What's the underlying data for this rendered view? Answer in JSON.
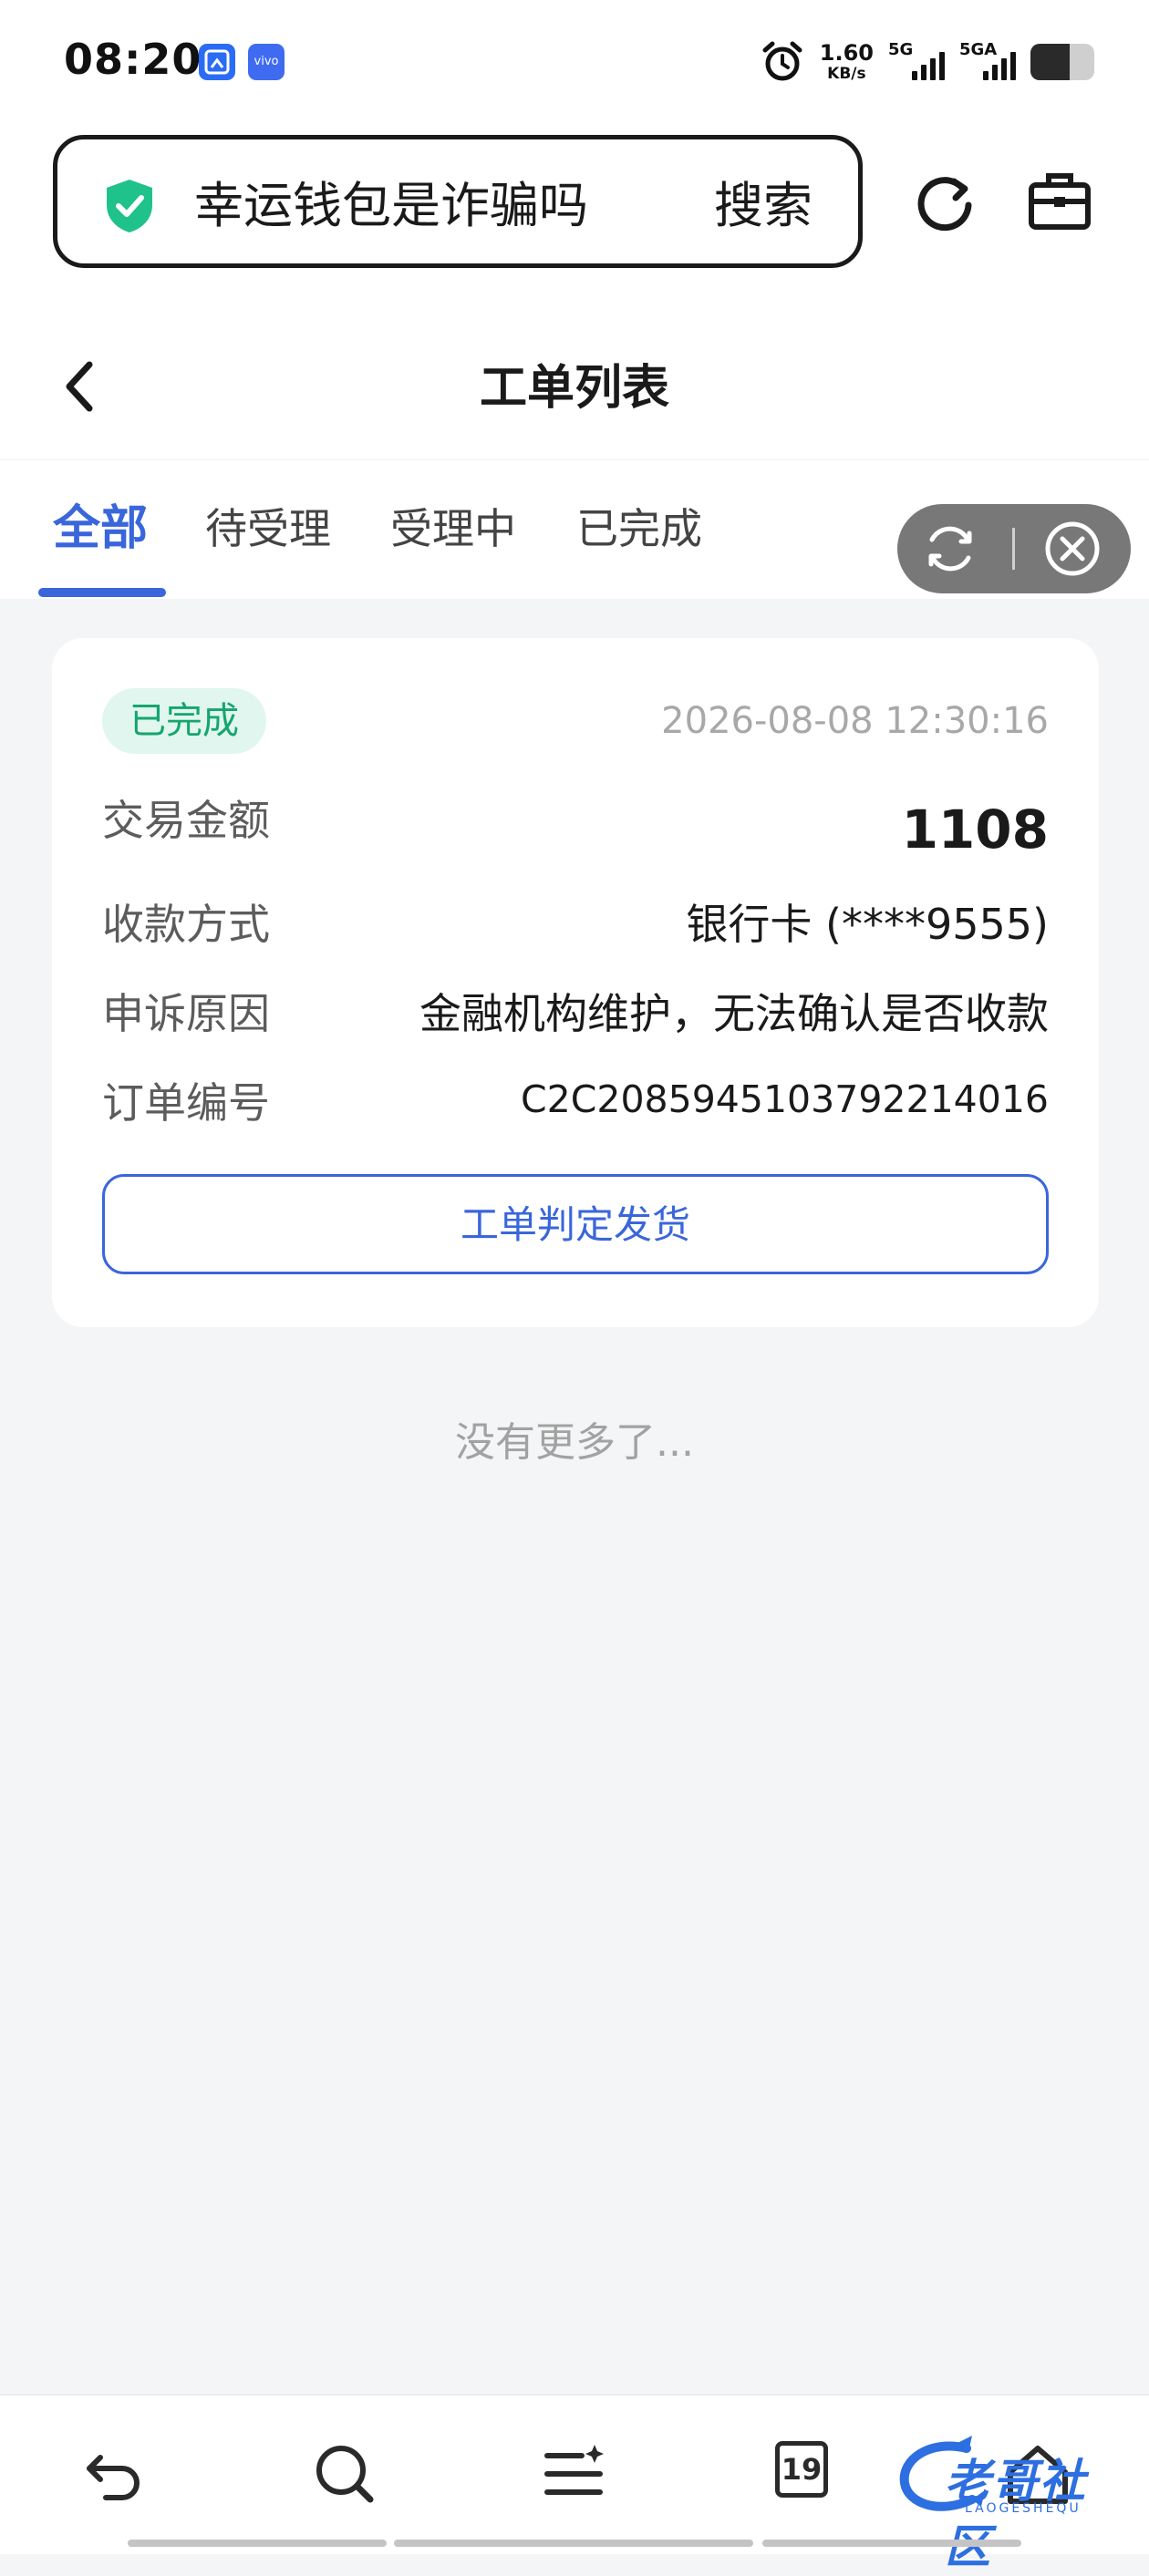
{
  "status_bar": {
    "time": "08:20",
    "notification_icons": [
      "screenshot-app-icon",
      "vivo-app-icon"
    ],
    "vivo_label": "vivo",
    "alarm_icon": "alarm-clock-icon",
    "speed_value": "1.60",
    "speed_unit": "KB/s",
    "sim1_label": "5G",
    "sim2_label": "5GA",
    "battery_level": 0.62
  },
  "browser": {
    "search_query": "幸运钱包是诈骗吗",
    "search_button": "搜索",
    "security_icon": "shield-check-icon",
    "refresh_icon": "refresh-icon",
    "toolbox_icon": "toolbox-icon"
  },
  "header": {
    "title": "工单列表",
    "back_icon": "chevron-left-icon"
  },
  "tabs": [
    {
      "label": "全部",
      "active": true
    },
    {
      "label": "待受理",
      "active": false
    },
    {
      "label": "受理中",
      "active": false
    },
    {
      "label": "已完成",
      "active": false
    }
  ],
  "capsule": {
    "refresh_icon": "refresh-icon",
    "close_icon": "close-circle-icon"
  },
  "order": {
    "status": "已完成",
    "time": "2026-08-08 12:30:16",
    "rows": [
      {
        "label": "交易金额",
        "value": "1108"
      },
      {
        "label": "收款方式",
        "value": "银行卡 (****9555)"
      },
      {
        "label": "申诉原因",
        "value": "金融机构维护，无法确认是否收款"
      },
      {
        "label": "订单编号",
        "value": "C2C2085945103792214016"
      }
    ],
    "action_button": "工单判定发货"
  },
  "list_end_text": "没有更多了...",
  "bottom_bar": {
    "back_icon": "undo-arrow-icon",
    "search_icon": "search-icon",
    "menu_icon": "menu-sparkle-icon",
    "tab_count": "19",
    "home_icon": "home-icon"
  },
  "watermark": {
    "text": "老哥社区",
    "sub_text": "LAOGESHEQU"
  },
  "colors": {
    "accent": "#3a66db",
    "success": "#16a56f",
    "success_bg": "#e0f6ee",
    "page_bg": "#f4f5f7"
  }
}
